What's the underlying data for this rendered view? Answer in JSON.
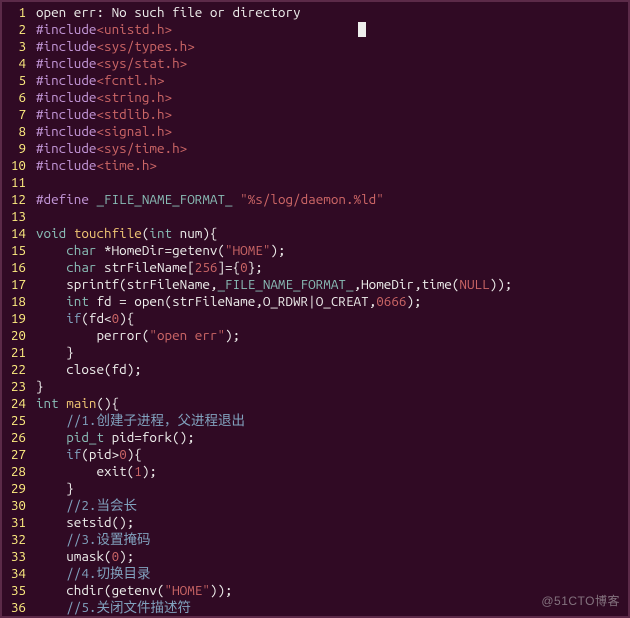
{
  "editor": {
    "watermark": "@51CTO博客",
    "lines": [
      {
        "num": 1,
        "tokens": [
          {
            "c": "tok-ident",
            "t": "open err: No such file or directory"
          }
        ]
      },
      {
        "num": 2,
        "tokens": [
          {
            "c": "tok-include",
            "t": "#include"
          },
          {
            "c": "tok-header",
            "t": "<unistd.h>"
          }
        ]
      },
      {
        "num": 3,
        "tokens": [
          {
            "c": "tok-include",
            "t": "#include"
          },
          {
            "c": "tok-header",
            "t": "<sys/types.h>"
          }
        ]
      },
      {
        "num": 4,
        "tokens": [
          {
            "c": "tok-include",
            "t": "#include"
          },
          {
            "c": "tok-header",
            "t": "<sys/stat.h>"
          }
        ]
      },
      {
        "num": 5,
        "tokens": [
          {
            "c": "tok-include",
            "t": "#include"
          },
          {
            "c": "tok-header",
            "t": "<fcntl.h>"
          }
        ]
      },
      {
        "num": 6,
        "tokens": [
          {
            "c": "tok-include",
            "t": "#include"
          },
          {
            "c": "tok-header",
            "t": "<string.h>"
          }
        ]
      },
      {
        "num": 7,
        "tokens": [
          {
            "c": "tok-include",
            "t": "#include"
          },
          {
            "c": "tok-header",
            "t": "<stdlib.h>"
          }
        ]
      },
      {
        "num": 8,
        "tokens": [
          {
            "c": "tok-include",
            "t": "#include"
          },
          {
            "c": "tok-header",
            "t": "<signal.h>"
          }
        ]
      },
      {
        "num": 9,
        "tokens": [
          {
            "c": "tok-include",
            "t": "#include"
          },
          {
            "c": "tok-header",
            "t": "<sys/time.h>"
          }
        ]
      },
      {
        "num": 10,
        "tokens": [
          {
            "c": "tok-include",
            "t": "#include"
          },
          {
            "c": "tok-header",
            "t": "<time.h>"
          }
        ]
      },
      {
        "num": 11,
        "tokens": []
      },
      {
        "num": 12,
        "tokens": [
          {
            "c": "tok-include",
            "t": "#define "
          },
          {
            "c": "tok-type",
            "t": "_FILE_NAME_FORMAT_"
          },
          {
            "c": "tok-ident",
            "t": " "
          },
          {
            "c": "tok-string",
            "t": "\"%s/log/daemon.%ld\""
          }
        ]
      },
      {
        "num": 13,
        "tokens": []
      },
      {
        "num": 14,
        "tokens": [
          {
            "c": "tok-type",
            "t": "void"
          },
          {
            "c": "tok-ident",
            "t": " "
          },
          {
            "c": "tok-func",
            "t": "touchfile"
          },
          {
            "c": "tok-ident",
            "t": "("
          },
          {
            "c": "tok-type",
            "t": "int"
          },
          {
            "c": "tok-ident",
            "t": " num){"
          }
        ]
      },
      {
        "num": 15,
        "tokens": [
          {
            "c": "tok-ident",
            "t": "    "
          },
          {
            "c": "tok-type",
            "t": "char"
          },
          {
            "c": "tok-ident",
            "t": " *HomeDir=getenv("
          },
          {
            "c": "tok-string",
            "t": "\"HOME\""
          },
          {
            "c": "tok-ident",
            "t": ");"
          }
        ]
      },
      {
        "num": 16,
        "tokens": [
          {
            "c": "tok-ident",
            "t": "    "
          },
          {
            "c": "tok-type",
            "t": "char"
          },
          {
            "c": "tok-ident",
            "t": " strFileName["
          },
          {
            "c": "tok-number",
            "t": "256"
          },
          {
            "c": "tok-ident",
            "t": "]={"
          },
          {
            "c": "tok-number",
            "t": "0"
          },
          {
            "c": "tok-ident",
            "t": "};"
          }
        ]
      },
      {
        "num": 17,
        "tokens": [
          {
            "c": "tok-ident",
            "t": "    sprintf(strFileName,"
          },
          {
            "c": "tok-type",
            "t": "_FILE_NAME_FORMAT_"
          },
          {
            "c": "tok-ident",
            "t": ",HomeDir,time("
          },
          {
            "c": "tok-const",
            "t": "NULL"
          },
          {
            "c": "tok-ident",
            "t": "));"
          }
        ]
      },
      {
        "num": 18,
        "tokens": [
          {
            "c": "tok-ident",
            "t": "    "
          },
          {
            "c": "tok-type",
            "t": "int"
          },
          {
            "c": "tok-ident",
            "t": " fd = open(strFileName,O_RDWR|O_CREAT,"
          },
          {
            "c": "tok-number",
            "t": "0666"
          },
          {
            "c": "tok-ident",
            "t": ");"
          }
        ]
      },
      {
        "num": 19,
        "tokens": [
          {
            "c": "tok-ident",
            "t": "    "
          },
          {
            "c": "tok-keyword",
            "t": "if"
          },
          {
            "c": "tok-ident",
            "t": "(fd<"
          },
          {
            "c": "tok-number",
            "t": "0"
          },
          {
            "c": "tok-ident",
            "t": "){"
          }
        ]
      },
      {
        "num": 20,
        "tokens": [
          {
            "c": "tok-ident",
            "t": "        perror("
          },
          {
            "c": "tok-string",
            "t": "\"open err\""
          },
          {
            "c": "tok-ident",
            "t": ");"
          }
        ]
      },
      {
        "num": 21,
        "tokens": [
          {
            "c": "tok-ident",
            "t": "    }"
          }
        ]
      },
      {
        "num": 22,
        "tokens": [
          {
            "c": "tok-ident",
            "t": "    close(fd);"
          }
        ]
      },
      {
        "num": 23,
        "tokens": [
          {
            "c": "tok-ident",
            "t": "}"
          }
        ]
      },
      {
        "num": 24,
        "tokens": [
          {
            "c": "tok-type",
            "t": "int"
          },
          {
            "c": "tok-ident",
            "t": " "
          },
          {
            "c": "tok-func",
            "t": "main"
          },
          {
            "c": "tok-ident",
            "t": "(){"
          }
        ]
      },
      {
        "num": 25,
        "tokens": [
          {
            "c": "tok-ident",
            "t": "    "
          },
          {
            "c": "tok-comment",
            "t": "//1.创建子进程，父进程退出"
          }
        ]
      },
      {
        "num": 26,
        "tokens": [
          {
            "c": "tok-ident",
            "t": "    "
          },
          {
            "c": "tok-type",
            "t": "pid_t"
          },
          {
            "c": "tok-ident",
            "t": " pid=fork();"
          }
        ]
      },
      {
        "num": 27,
        "tokens": [
          {
            "c": "tok-ident",
            "t": "    "
          },
          {
            "c": "tok-keyword",
            "t": "if"
          },
          {
            "c": "tok-ident",
            "t": "(pid>"
          },
          {
            "c": "tok-number",
            "t": "0"
          },
          {
            "c": "tok-ident",
            "t": "){"
          }
        ]
      },
      {
        "num": 28,
        "tokens": [
          {
            "c": "tok-ident",
            "t": "        exit("
          },
          {
            "c": "tok-number",
            "t": "1"
          },
          {
            "c": "tok-ident",
            "t": ");"
          }
        ]
      },
      {
        "num": 29,
        "tokens": [
          {
            "c": "tok-ident",
            "t": "    }"
          }
        ]
      },
      {
        "num": 30,
        "tokens": [
          {
            "c": "tok-ident",
            "t": "    "
          },
          {
            "c": "tok-comment",
            "t": "//2.当会长"
          }
        ]
      },
      {
        "num": 31,
        "tokens": [
          {
            "c": "tok-ident",
            "t": "    setsid();"
          }
        ]
      },
      {
        "num": 32,
        "tokens": [
          {
            "c": "tok-ident",
            "t": "    "
          },
          {
            "c": "tok-comment",
            "t": "//3.设置掩码"
          }
        ]
      },
      {
        "num": 33,
        "tokens": [
          {
            "c": "tok-ident",
            "t": "    umask("
          },
          {
            "c": "tok-number",
            "t": "0"
          },
          {
            "c": "tok-ident",
            "t": ");"
          }
        ]
      },
      {
        "num": 34,
        "tokens": [
          {
            "c": "tok-ident",
            "t": "    "
          },
          {
            "c": "tok-comment",
            "t": "//4.切换目录"
          }
        ]
      },
      {
        "num": 35,
        "tokens": [
          {
            "c": "tok-ident",
            "t": "    chdir(getenv("
          },
          {
            "c": "tok-string",
            "t": "\"HOME\""
          },
          {
            "c": "tok-ident",
            "t": "));"
          }
        ]
      },
      {
        "num": 36,
        "tokens": [
          {
            "c": "tok-ident",
            "t": "    "
          },
          {
            "c": "tok-comment",
            "t": "//5.关闭文件描述符"
          }
        ]
      }
    ]
  }
}
